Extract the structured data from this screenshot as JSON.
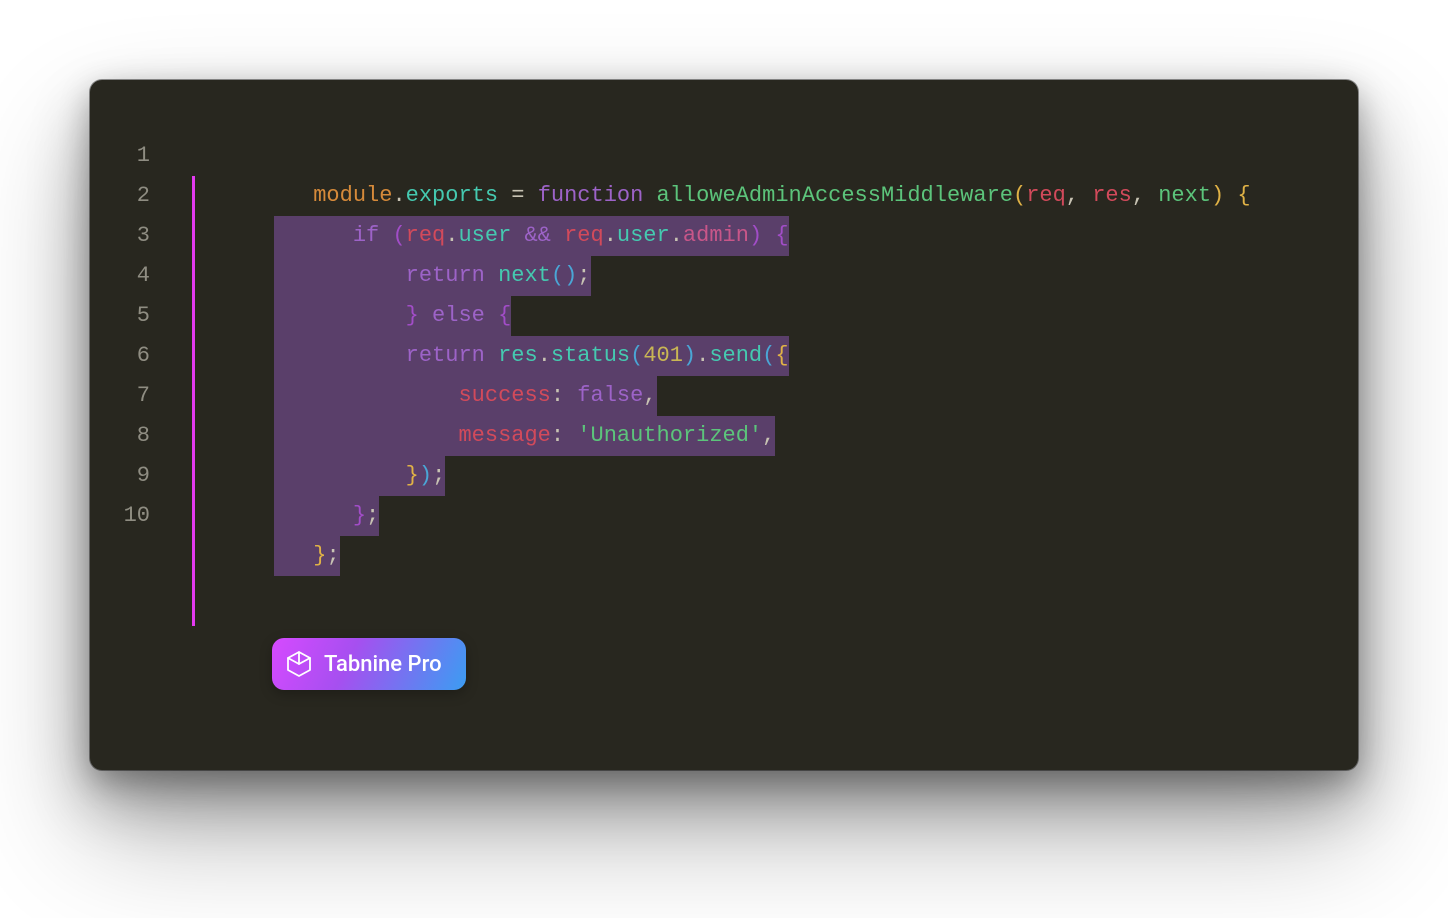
{
  "gutter": {
    "start": 1,
    "end": 10
  },
  "code": {
    "line1": {
      "pad": "   ",
      "t1": "module",
      "t2": ".",
      "t3": "exports",
      "t4": " = ",
      "t5": "function",
      "sp": " ",
      "t6": "alloweAdminAccessMiddleware",
      "t7": "(",
      "t8": "req",
      "t9": ", ",
      "t10": "res",
      "t11": ", ",
      "t12": "next",
      "t13": ")",
      "t14": " {"
    },
    "line2": {
      "pad": "      ",
      "t1": "if ",
      "t2": "(",
      "t3": "req",
      "t4": ".",
      "t5": "user",
      "t6": " && ",
      "t7": "req",
      "t8": ".",
      "t9": "user",
      "t10": ".",
      "t11": "admin",
      "t12": ")",
      "t13": " {"
    },
    "line3": {
      "pad": "          ",
      "t1": "return",
      "t2": " next",
      "t3": "()",
      "t4": ";"
    },
    "line4": {
      "pad": "          ",
      "t1": "}",
      "t2": " else ",
      "t3": "{"
    },
    "line5": {
      "pad": "          ",
      "t1": "return",
      "t2": " res",
      "t3": ".",
      "t4": "status",
      "t5": "(",
      "t6": "401",
      "t7": ")",
      "t8": ".",
      "t9": "send",
      "t10": "(",
      "t11": "{"
    },
    "line6": {
      "pad": "              ",
      "t1": "success",
      "t2": ": ",
      "t3": "false",
      "t4": ","
    },
    "line7": {
      "pad": "              ",
      "t1": "message",
      "t2": ": ",
      "t3": "'Unauthorized'",
      "t4": ","
    },
    "line8": {
      "pad": "          ",
      "t1": "}",
      "t2": ")",
      "t3": ";"
    },
    "line9": {
      "pad": "      ",
      "t1": "}",
      "t2": ";"
    },
    "line10": {
      "pad": "   ",
      "t1": "}",
      "t2": ";"
    }
  },
  "badge": {
    "label": "Tabnine Pro"
  }
}
